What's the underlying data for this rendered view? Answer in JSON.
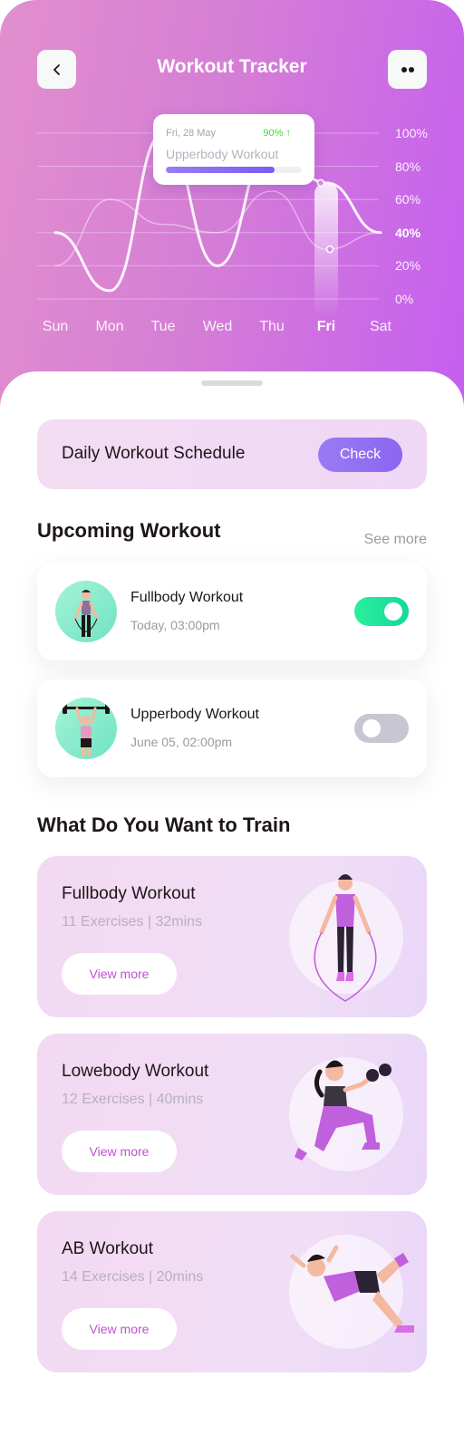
{
  "header": {
    "title": "Workout Tracker",
    "back_icon": "chevron-left-icon",
    "more_icon": "more-dots-icon"
  },
  "chart_data": {
    "type": "line",
    "categories": [
      "Sun",
      "Mon",
      "Tue",
      "Wed",
      "Thu",
      "Fri",
      "Sat"
    ],
    "series": [
      {
        "values": [
          40,
          5,
          100,
          20,
          95,
          70,
          40
        ]
      },
      {
        "values": [
          20,
          60,
          45,
          40,
          65,
          30,
          40
        ]
      }
    ],
    "yticks": [
      "100%",
      "80%",
      "60%",
      "40%",
      "20%",
      "0%"
    ],
    "highlight_category": "Fri",
    "highlight_tick": "40%",
    "ylim": [
      0,
      100
    ],
    "grid": true,
    "colors": {
      "line": "#ffffff",
      "highlight": "#ffffff"
    }
  },
  "tooltip": {
    "date": "Fri, 28 May",
    "percent": "90% ↑",
    "workout": "Upperbody Workout",
    "progress": 0.8,
    "accent": "#42d742"
  },
  "schedule": {
    "title": "Daily Workout Schedule",
    "button": "Check"
  },
  "upcoming": {
    "title": "Upcoming Workout",
    "see_more": "See more",
    "items": [
      {
        "name": "Fullbody Workout",
        "time": "Today, 03:00pm",
        "enabled": true
      },
      {
        "name": "Upperbody Workout",
        "time": "June 05, 02:00pm",
        "enabled": false
      }
    ]
  },
  "train": {
    "title": "What Do You Want to Train",
    "items": [
      {
        "name": "Fullbody Workout",
        "detail": "11 Exercises | 32mins",
        "button": "View more"
      },
      {
        "name": "Lowebody Workout",
        "detail": "12 Exercises | 40mins",
        "button": "View more"
      },
      {
        "name": "AB Workout",
        "detail": "14 Exercises | 20mins",
        "button": "View more"
      }
    ]
  },
  "colors": {
    "brand_purple": "#c45ef0",
    "brand_pink": "#e28fcd",
    "toggle_on": "#2cee9c",
    "toggle_off": "#c8c6d3",
    "text_dark": "#1d1617",
    "text_gray": "#9a9a9f"
  }
}
